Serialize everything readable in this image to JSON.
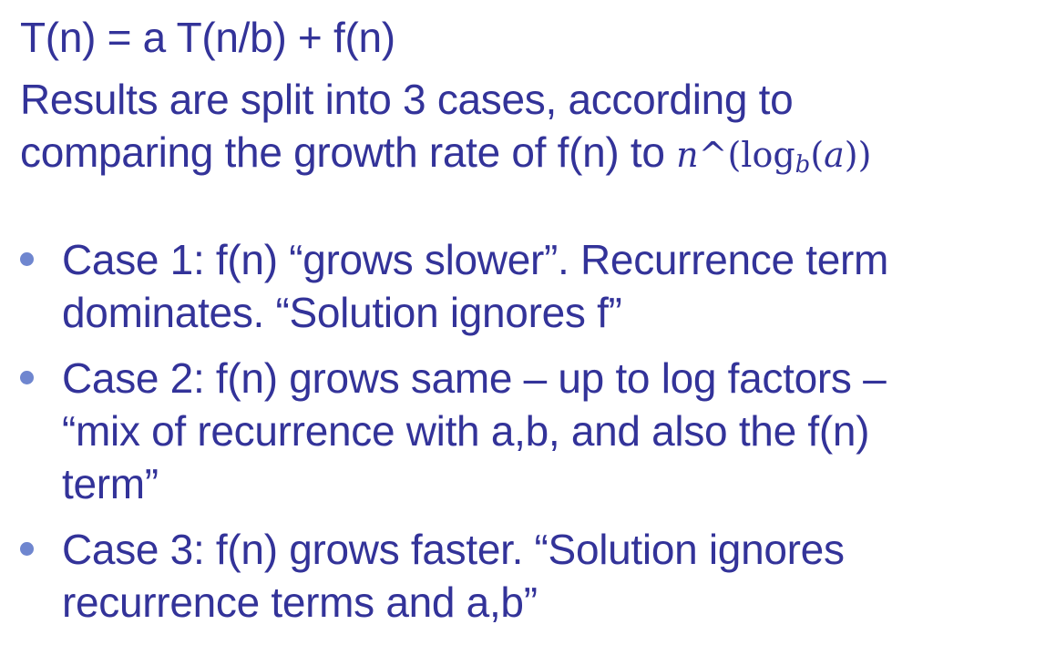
{
  "formula": "T(n) = a T(n/b) + f(n)",
  "intro": {
    "line1": "Results are split into 3 cases, according to",
    "line2_text": "comparing the growth rate of f(n) to ",
    "math": {
      "n": "n",
      "caret_paren": "^(",
      "log": "log",
      "base": "b",
      "open": "(",
      "arg": "a",
      "close": "))"
    }
  },
  "bullets": [
    {
      "lines": [
        "Case 1: f(n) “grows slower”. Recurrence term",
        "dominates. “Solution ignores f”"
      ]
    },
    {
      "lines": [
        "Case 2: f(n) grows same – up to log factors –",
        "“mix of recurrence with a,b, and also the f(n)",
        "term”"
      ]
    },
    {
      "lines": [
        "Case 3: f(n) grows faster. “Solution ignores",
        "recurrence terms and a,b”"
      ]
    }
  ],
  "colors": {
    "text": "#333399",
    "bullet": "#6f86cf",
    "background": "#ffffff"
  }
}
